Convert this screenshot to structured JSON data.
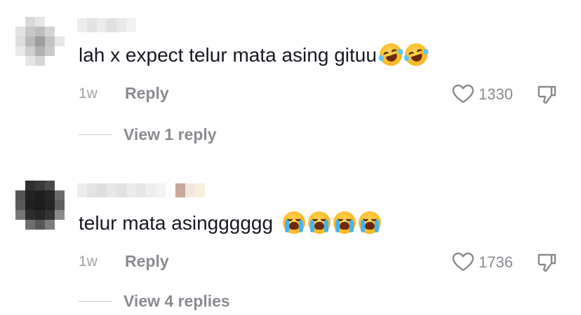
{
  "comments": [
    {
      "text": "lah x expect telur mata asing gituu",
      "emojis": [
        "rolling-on-floor-laughing",
        "rolling-on-floor-laughing"
      ],
      "time": "1w",
      "reply_label": "Reply",
      "likes": "1330",
      "view_replies": "View 1 reply"
    },
    {
      "text": "telur mata asingggggg",
      "emojis": [
        "loudly-crying-face",
        "loudly-crying-face",
        "loudly-crying-face",
        "loudly-crying-face"
      ],
      "time": "1w",
      "reply_label": "Reply",
      "likes": "1736",
      "view_replies": "View 4 replies"
    }
  ],
  "icons": {
    "like": "heart-outline-icon",
    "dislike": "thumbs-down-icon"
  },
  "colors": {
    "primary_text": "#161823",
    "secondary_text": "#8a8b91",
    "timestamp": "#a1a2a7"
  }
}
